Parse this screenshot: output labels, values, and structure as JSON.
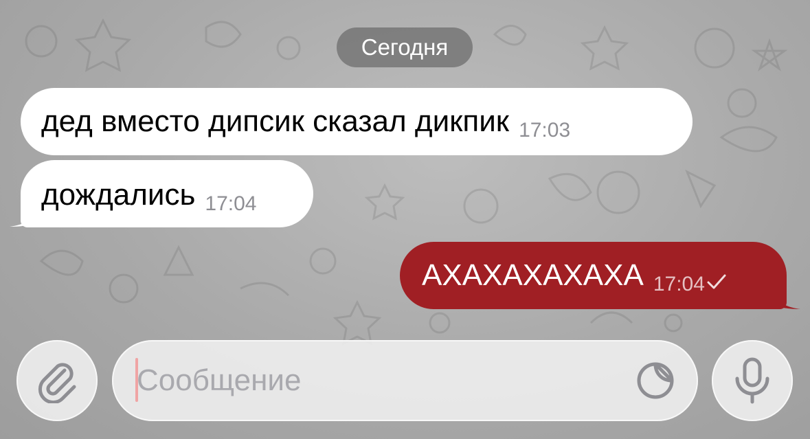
{
  "date_separator": "Сегодня",
  "messages": [
    {
      "direction": "incoming",
      "text": "дед вместо дипсик сказал дикпик",
      "time": "17:03"
    },
    {
      "direction": "incoming",
      "text": "дождались",
      "time": "17:04"
    },
    {
      "direction": "outgoing",
      "text": "АХАХАХАХАХА",
      "time": "17:04",
      "status_icon": "single-check-icon"
    }
  ],
  "composer": {
    "placeholder": "Сообщение",
    "value": "",
    "attach_icon": "paperclip-icon",
    "sticker_icon": "sticker-icon",
    "mic_icon": "microphone-icon"
  },
  "colors": {
    "outgoing_bubble": "#a01f24",
    "incoming_bubble": "#ffffff",
    "background": "#acacac"
  }
}
